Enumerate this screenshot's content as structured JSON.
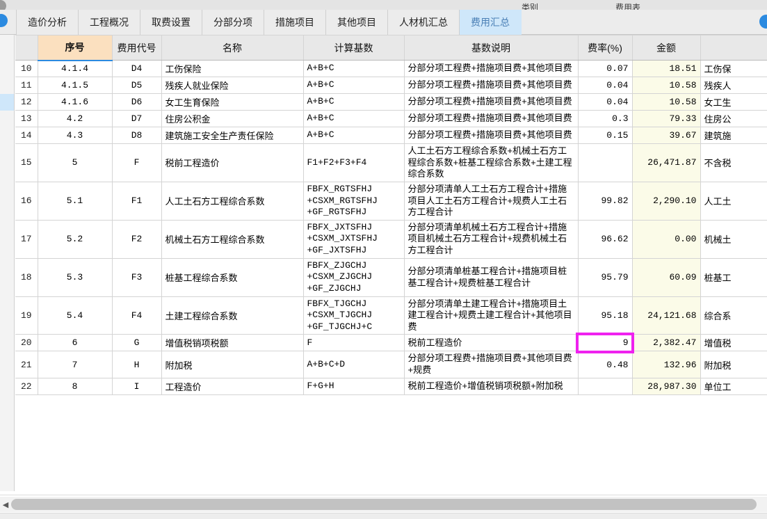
{
  "window": {
    "cut_label_1": "类别",
    "cut_label_2": "费用表"
  },
  "tabs": [
    {
      "label": "造价分析",
      "active": false
    },
    {
      "label": "工程概况",
      "active": false
    },
    {
      "label": "取费设置",
      "active": false
    },
    {
      "label": "分部分项",
      "active": false
    },
    {
      "label": "措施项目",
      "active": false
    },
    {
      "label": "其他项目",
      "active": false
    },
    {
      "label": "人材机汇总",
      "active": false
    },
    {
      "label": "费用汇总",
      "active": true
    }
  ],
  "table": {
    "columns": [
      {
        "key": "rownum",
        "label": ""
      },
      {
        "key": "seq",
        "label": "序号"
      },
      {
        "key": "code",
        "label": "费用代号"
      },
      {
        "key": "name",
        "label": "名称"
      },
      {
        "key": "base",
        "label": "计算基数"
      },
      {
        "key": "desc",
        "label": "基数说明"
      },
      {
        "key": "rate",
        "label": "费率(%)"
      },
      {
        "key": "amount",
        "label": "金额"
      },
      {
        "key": "remark",
        "label": ""
      }
    ],
    "rows": [
      {
        "rownum": "10",
        "seq": "4.1.4",
        "code": "D4",
        "name": "工伤保险",
        "base": "A+B+C",
        "desc": "分部分项工程费+措施项目费+其他项目费",
        "rate": "0.07",
        "amount": "18.51",
        "remark": "工伤保"
      },
      {
        "rownum": "11",
        "seq": "4.1.5",
        "code": "D5",
        "name": "残疾人就业保险",
        "base": "A+B+C",
        "desc": "分部分项工程费+措施项目费+其他项目费",
        "rate": "0.04",
        "amount": "10.58",
        "remark": "残疾人"
      },
      {
        "rownum": "12",
        "seq": "4.1.6",
        "code": "D6",
        "name": "女工生育保险",
        "base": "A+B+C",
        "desc": "分部分项工程费+措施项目费+其他项目费",
        "rate": "0.04",
        "amount": "10.58",
        "remark": "女工生"
      },
      {
        "rownum": "13",
        "seq": "4.2",
        "code": "D7",
        "name": "住房公积金",
        "base": "A+B+C",
        "desc": "分部分项工程费+措施项目费+其他项目费",
        "rate": "0.3",
        "amount": "79.33",
        "remark": "住房公"
      },
      {
        "rownum": "14",
        "seq": "4.3",
        "code": "D8",
        "name": "建筑施工安全生产责任保险",
        "base": "A+B+C",
        "desc": "分部分项工程费+措施项目费+其他项目费",
        "rate": "0.15",
        "amount": "39.67",
        "remark": "建筑施"
      },
      {
        "rownum": "15",
        "seq": "5",
        "code": "F",
        "name": "税前工程造价",
        "base": "F1+F2+F3+F4",
        "desc": "人工土石方工程综合系数+机械土石方工程综合系数+桩基工程综合系数+土建工程综合系数",
        "rate": "",
        "amount": "26,471.87",
        "remark": "不含税"
      },
      {
        "rownum": "16",
        "seq": "5.1",
        "code": "F1",
        "name": "人工土石方工程综合系数",
        "base": "FBFX_RGTSFHJ\n+CSXM_RGTSFHJ\n+GF_RGTSFHJ",
        "desc": "分部分项清单人工土石方工程合计+措施项目人工土石方工程合计+规费人工土石方工程合计",
        "rate": "99.82",
        "amount": "2,290.10",
        "remark": "人工土"
      },
      {
        "rownum": "17",
        "seq": "5.2",
        "code": "F2",
        "name": "机械土石方工程综合系数",
        "base": "FBFX_JXTSFHJ\n+CSXM_JXTSFHJ\n+GF_JXTSFHJ",
        "desc": "分部分项清单机械土石方工程合计+措施项目机械土石方工程合计+规费机械土石方工程合计",
        "rate": "96.62",
        "amount": "0.00",
        "remark": "机械土"
      },
      {
        "rownum": "18",
        "seq": "5.3",
        "code": "F3",
        "name": "桩基工程综合系数",
        "base": "FBFX_ZJGCHJ\n+CSXM_ZJGCHJ\n+GF_ZJGCHJ",
        "desc": "分部分项清单桩基工程合计+措施项目桩基工程合计+规费桩基工程合计",
        "rate": "95.79",
        "amount": "60.09",
        "remark": "桩基工"
      },
      {
        "rownum": "19",
        "seq": "5.4",
        "code": "F4",
        "name": "土建工程综合系数",
        "base": "FBFX_TJGCHJ\n+CSXM_TJGCHJ\n+GF_TJGCHJ+C",
        "desc": "分部分项清单土建工程合计+措施项目土建工程合计+规费土建工程合计+其他项目费",
        "rate": "95.18",
        "amount": "24,121.68",
        "remark": "综合系"
      },
      {
        "rownum": "20",
        "seq": "6",
        "code": "G",
        "name": "增值税销项税额",
        "base": "F",
        "desc": "税前工程造价",
        "rate": "9",
        "amount": "2,382.47",
        "remark": "增值税"
      },
      {
        "rownum": "21",
        "seq": "7",
        "code": "H",
        "name": "附加税",
        "base": "A+B+C+D",
        "desc": "分部分项工程费+措施项目费+其他项目费+规费",
        "rate": "0.48",
        "amount": "132.96",
        "remark": "附加税"
      },
      {
        "rownum": "22",
        "seq": "8",
        "code": "I",
        "name": "工程造价",
        "base": "F+G+H",
        "desc": "税前工程造价+增值税销项税额+附加税",
        "rate": "",
        "amount": "28,987.30",
        "remark": "单位工"
      }
    ]
  },
  "annotation": {
    "highlight_color": "#ef21ef",
    "highlight_target_row": "20",
    "highlight_target_column": "费率(%)",
    "highlight_value": "9"
  },
  "colors": {
    "active_tab_bg": "#cfe7fa",
    "active_tab_text": "#4a7fb5",
    "seq_header_bg": "#fbe0bf",
    "amount_cell_bg": "#fbfbe8",
    "accent_blue": "#2b8ae0"
  },
  "scrollbar": {
    "left_arrow": "◀"
  }
}
